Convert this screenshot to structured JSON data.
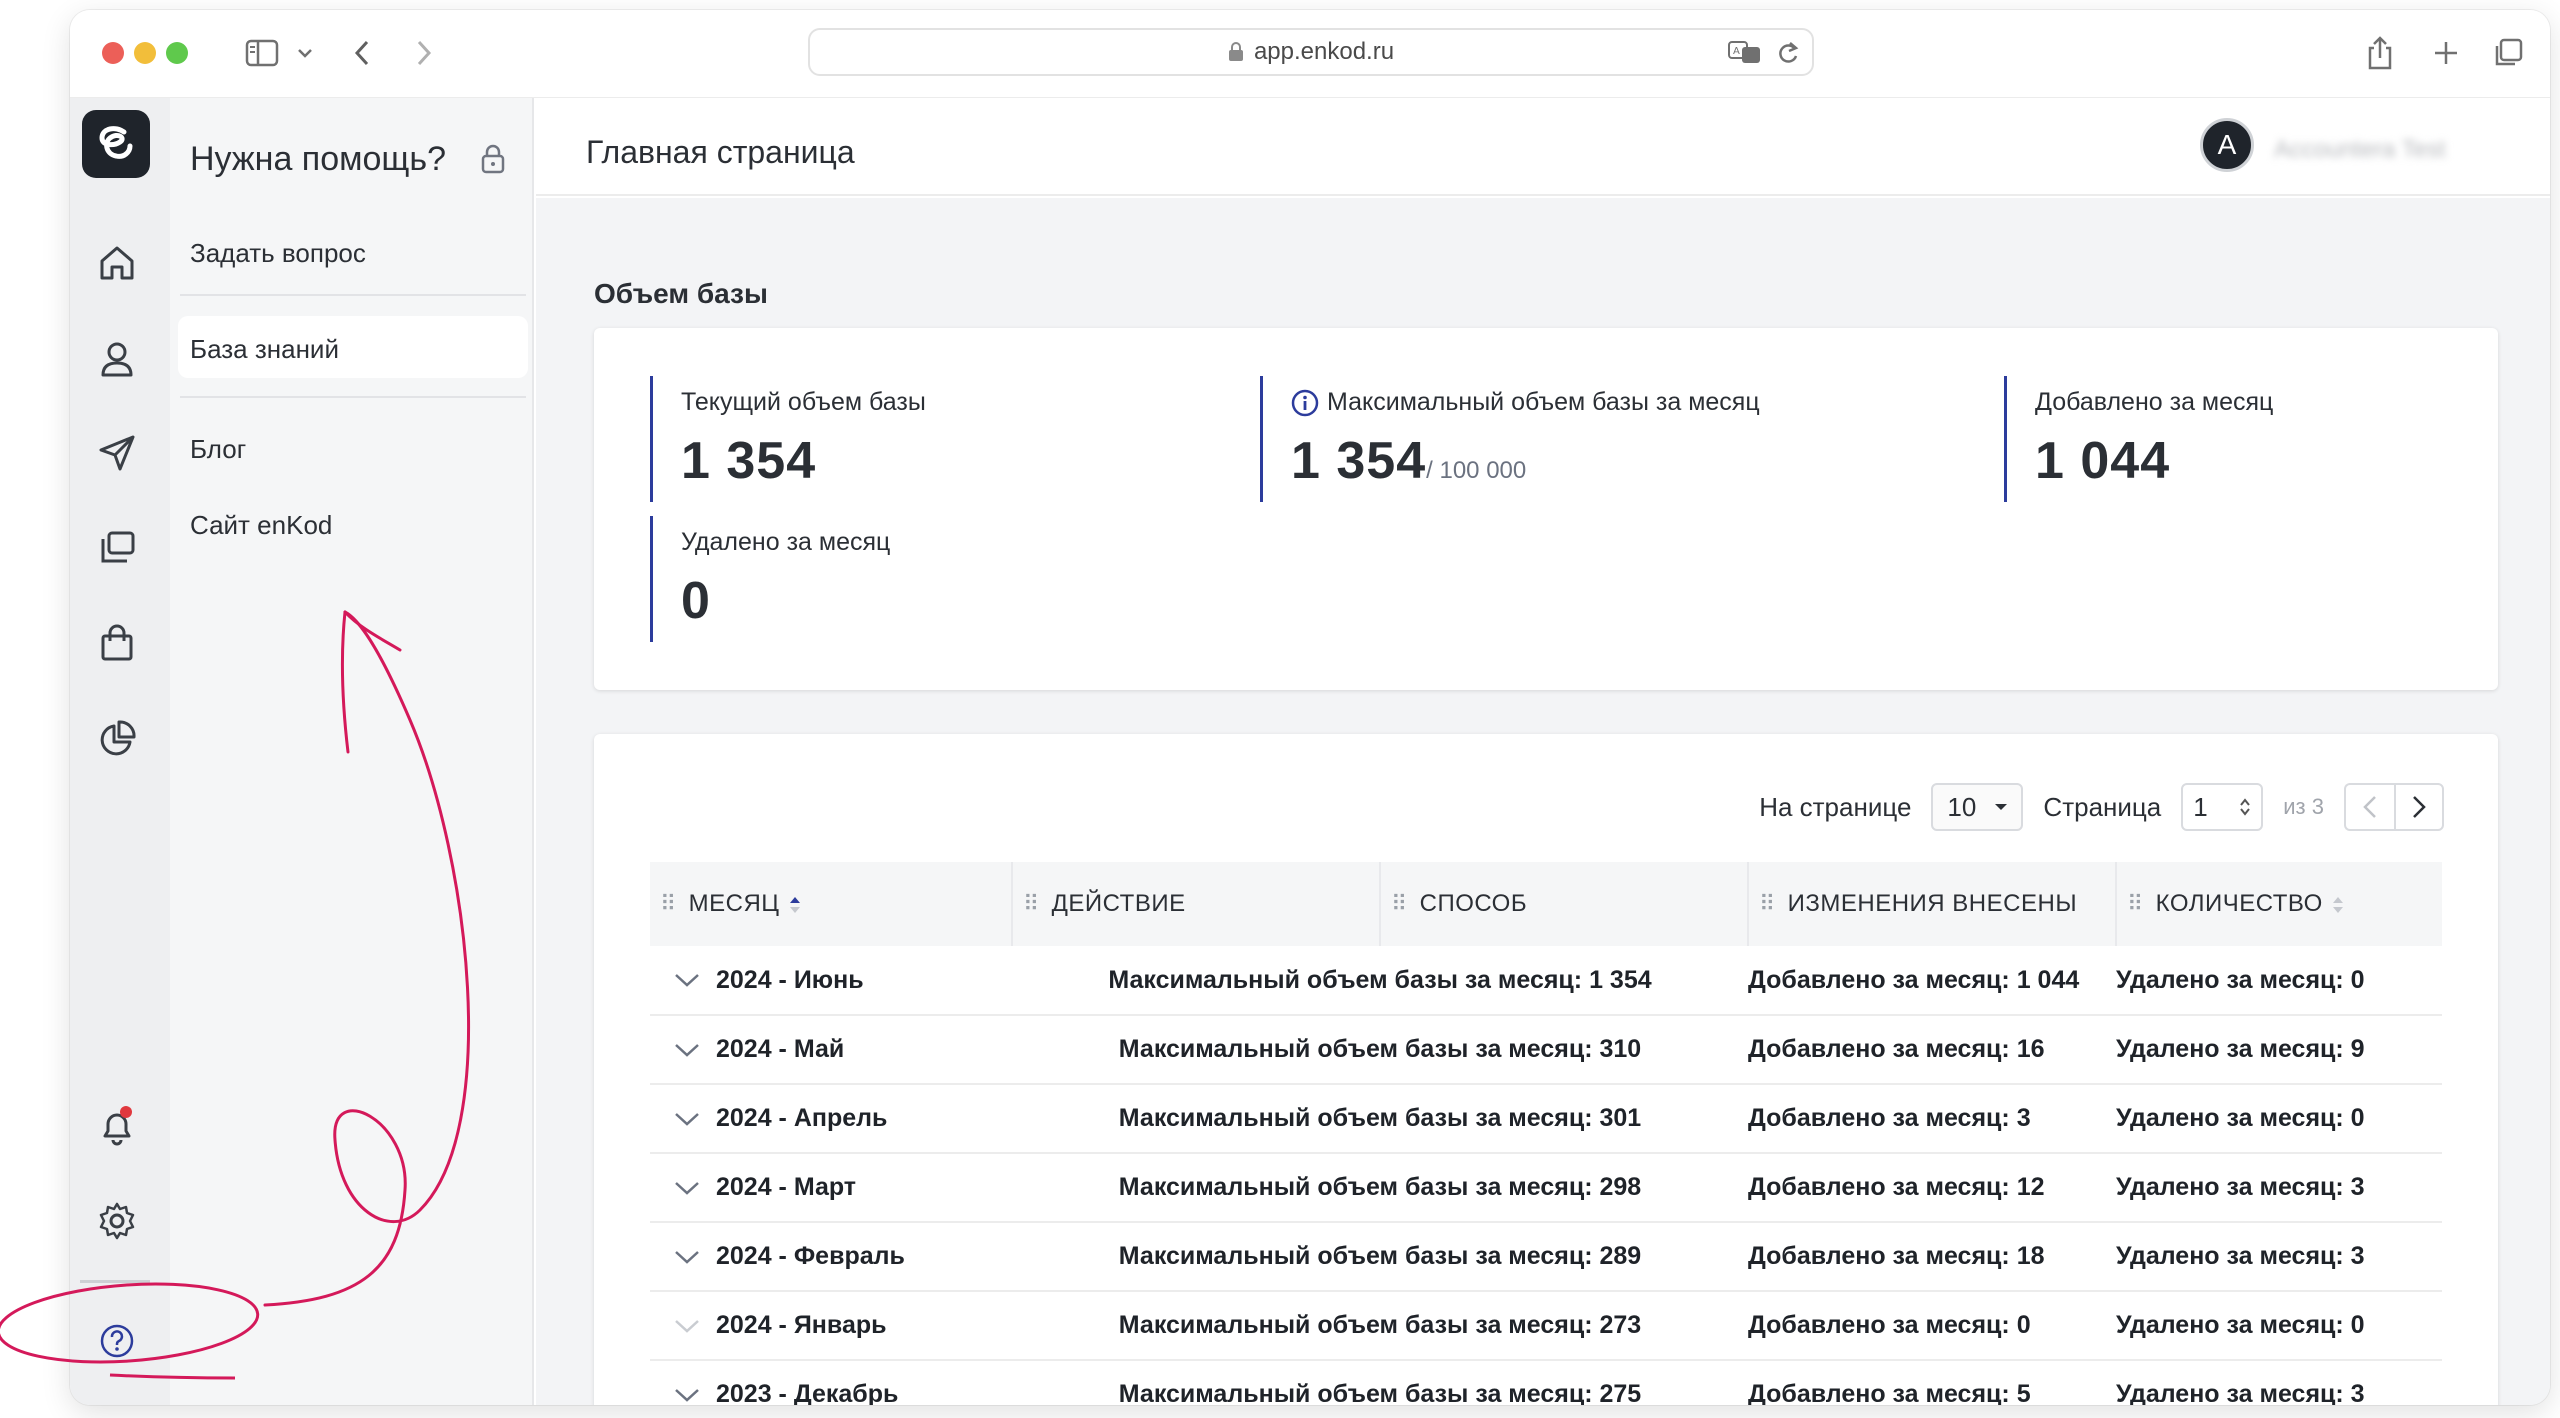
{
  "browser": {
    "url": "app.enkod.ru"
  },
  "help_panel": {
    "title": "Нужна помощь?",
    "items": [
      {
        "label": "Задать вопрос"
      },
      {
        "label": "База знаний"
      },
      {
        "label": "Блог"
      },
      {
        "label": "Сайт enKod"
      }
    ]
  },
  "header": {
    "title": "Главная страница",
    "avatar_letter": "A",
    "account_name": "Accountera Test"
  },
  "section": {
    "title": "Объем базы"
  },
  "stats": {
    "current_label": "Текущий объем базы",
    "current_value": "1 354",
    "max_label": "Максимальный объем базы за месяц",
    "max_value": "1 354",
    "max_limit": "/ 100 000",
    "added_label": "Добавлено за месяц",
    "added_value": "1 044",
    "deleted_label": "Удалено за месяц",
    "deleted_value": "0"
  },
  "pager": {
    "per_page_label": "На странице",
    "per_page_value": "10",
    "page_label": "Страница",
    "page_value": "1",
    "of_label": "из 3"
  },
  "table": {
    "columns": [
      "МЕСЯЦ",
      "ДЕЙСТВИЕ",
      "СПОСОБ",
      "ИЗМЕНЕНИЯ ВНЕСЕНЫ",
      "КОЛИЧЕСТВО"
    ],
    "rows": [
      {
        "month": "2024 - Июнь",
        "max": "Максимальный объем базы за месяц: 1 354",
        "added": "Добавлено за месяц: 1 044",
        "deleted": "Удалено за месяц: 0"
      },
      {
        "month": "2024 - Май",
        "max": "Максимальный объем базы за месяц: 310",
        "added": "Добавлено за месяц: 16",
        "deleted": "Удалено за месяц: 9"
      },
      {
        "month": "2024 - Апрель",
        "max": "Максимальный объем базы за месяц: 301",
        "added": "Добавлено за месяц: 3",
        "deleted": "Удалено за месяц: 0"
      },
      {
        "month": "2024 - Март",
        "max": "Максимальный объем базы за месяц: 298",
        "added": "Добавлено за месяц: 12",
        "deleted": "Удалено за месяц: 3"
      },
      {
        "month": "2024 - Февраль",
        "max": "Максимальный объем базы за месяц: 289",
        "added": "Добавлено за месяц: 18",
        "deleted": "Удалено за месяц: 3"
      },
      {
        "month": "2024 - Январь",
        "max": "Максимальный объем базы за месяц: 273",
        "added": "Добавлено за месяц: 0",
        "deleted": "Удалено за месяц: 0"
      },
      {
        "month": "2023 - Декабрь",
        "max": "Максимальный объем базы за месяц: 275",
        "added": "Добавлено за месяц: 5",
        "deleted": "Удалено за месяц: 3"
      }
    ]
  },
  "colors": {
    "accent": "#2c3c9c",
    "annotation": "#d4195a"
  }
}
